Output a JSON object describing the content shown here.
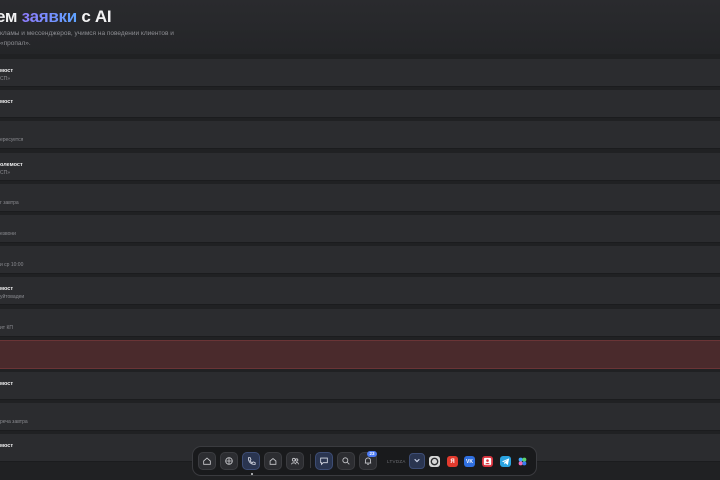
{
  "header": {
    "title_prefix": "ем",
    "title_accent": "заявки",
    "title_suffix": "с AI",
    "subtitle": "кламы и мессенджеров, учимся на поведении клиентов и «пропал»."
  },
  "rows": [
    {
      "title": "мост",
      "sub": "СП»",
      "status": "normal"
    },
    {
      "title": "мост",
      "sub": "",
      "status": "normal"
    },
    {
      "title": "",
      "sub": "ересуется",
      "status": "normal"
    },
    {
      "title": "олемост",
      "sub": "СП»",
      "status": "normal"
    },
    {
      "title": "",
      "sub": "г завтра",
      "status": "normal"
    },
    {
      "title": "",
      "sub": "езвони",
      "status": "normal"
    },
    {
      "title": "",
      "sub": "и ср 10:00",
      "status": "normal"
    },
    {
      "title": "мост",
      "sub": "уйтовадеи",
      "status": "normal"
    },
    {
      "title": "",
      "sub": "ит КП",
      "status": "normal"
    },
    {
      "title": "",
      "sub": "",
      "status": "alert"
    },
    {
      "title": "мост",
      "sub": "",
      "status": "normal"
    },
    {
      "title": "",
      "sub": "реча завтра",
      "status": "normal"
    },
    {
      "title": "мост",
      "sub": "",
      "status": "normal"
    }
  ],
  "dock": {
    "badge_count": "23",
    "section_label": "LTVDZA",
    "colors": {
      "active_button": "#2a3550",
      "badge": "#4d7bf3",
      "alert_row": "#4a2a2c"
    },
    "buttons": [
      {
        "name": "home-icon"
      },
      {
        "name": "globe-icon"
      },
      {
        "name": "phone-icon",
        "active": true
      },
      {
        "name": "house-icon"
      },
      {
        "name": "users-icon"
      },
      {
        "name": "chat-icon"
      },
      {
        "name": "search-icon"
      },
      {
        "name": "bell-icon"
      }
    ],
    "messengers": [
      {
        "name": "avito-icon",
        "color": "#d7d7d7"
      },
      {
        "name": "yandex-icon",
        "color": "#e33b2e"
      },
      {
        "name": "vk-icon",
        "color": "#2f6fe0"
      },
      {
        "name": "profile-card-icon",
        "color": "#d8343f"
      },
      {
        "name": "telegram-icon",
        "color": "#2aa3e0"
      },
      {
        "name": "apps-icon",
        "color": "#2b2c2f"
      }
    ]
  }
}
